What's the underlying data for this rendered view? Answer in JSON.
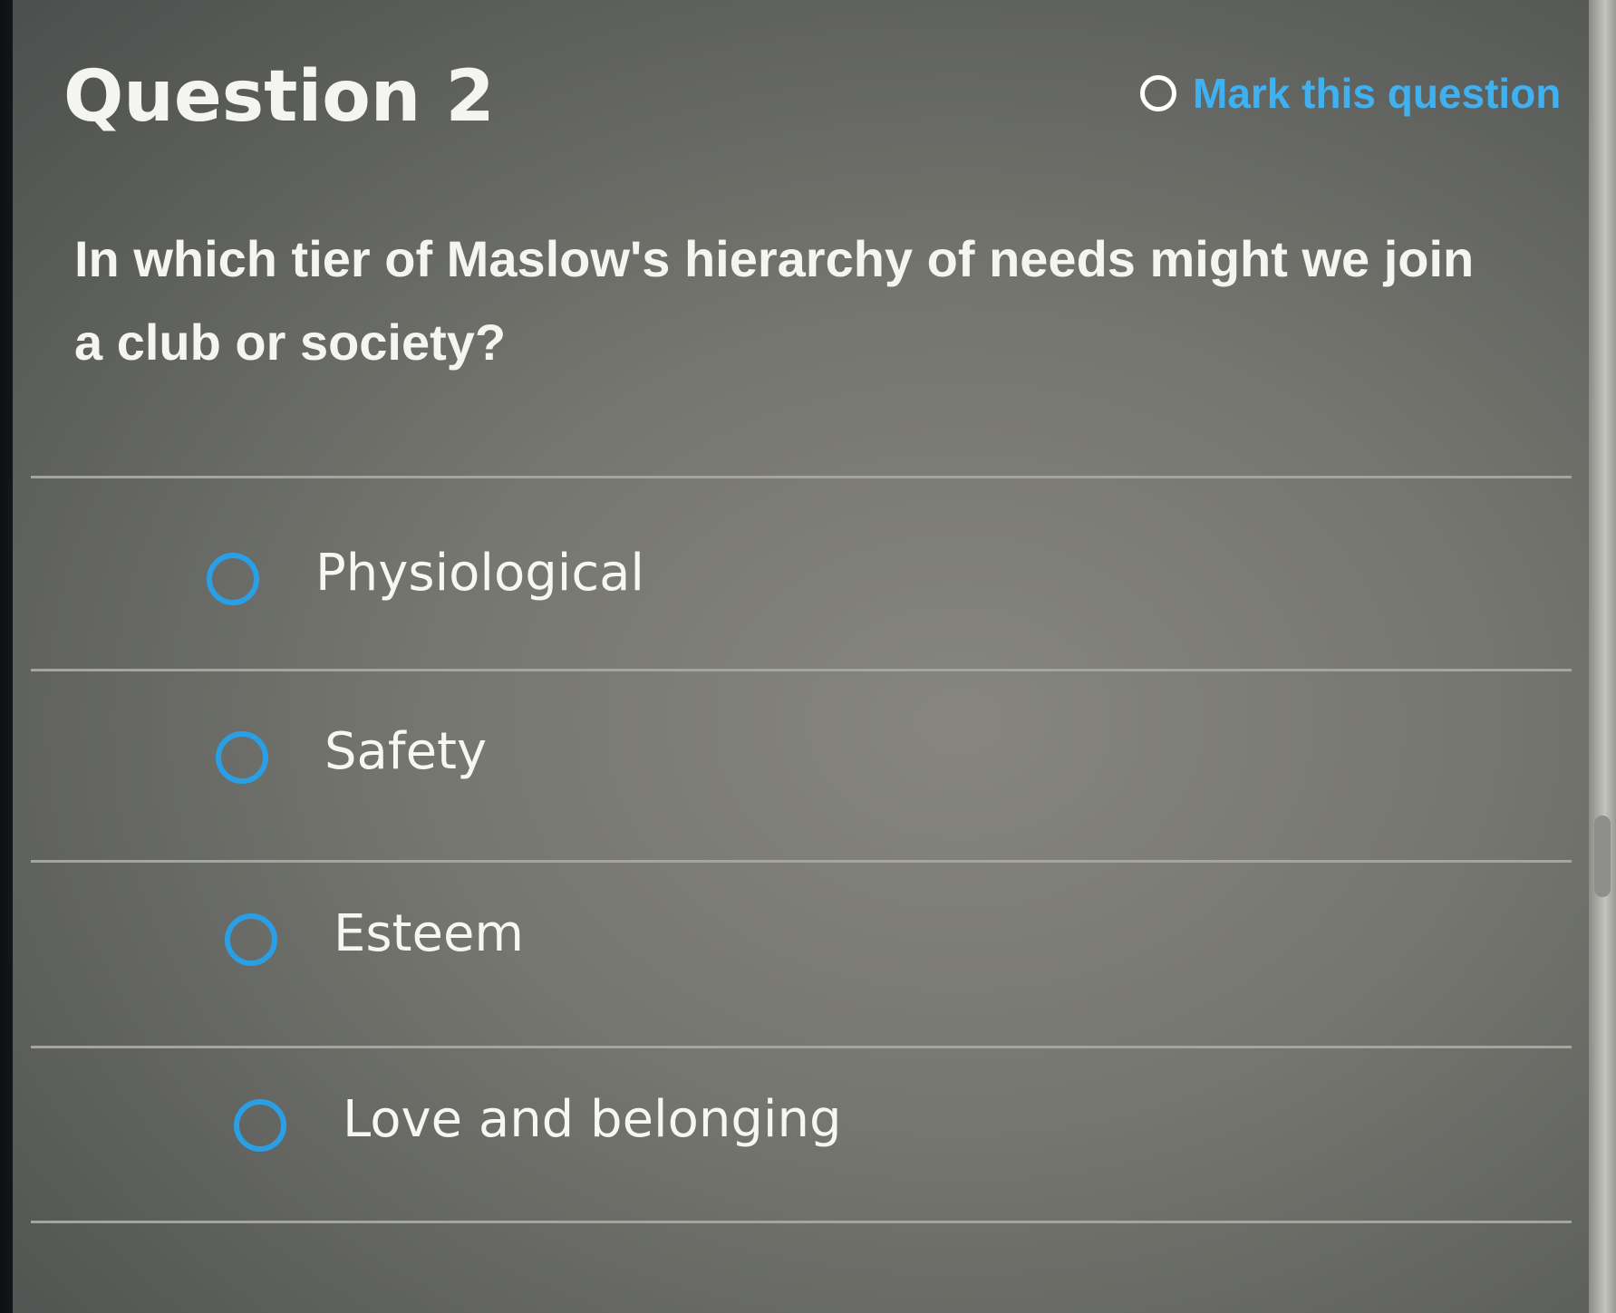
{
  "question": {
    "title": "Question 2",
    "mark_label": "Mark this question",
    "text": "In which tier of Maslow's hierarchy of needs might we join a club or society?"
  },
  "options": [
    {
      "label": "Physiological"
    },
    {
      "label": "Safety"
    },
    {
      "label": "Esteem"
    },
    {
      "label": "Love and belonging"
    }
  ],
  "colors": {
    "accent": "#2a9fe6",
    "mark_link": "#3fb0f0",
    "panel": "#75766f",
    "text": "#f4f4f0"
  }
}
